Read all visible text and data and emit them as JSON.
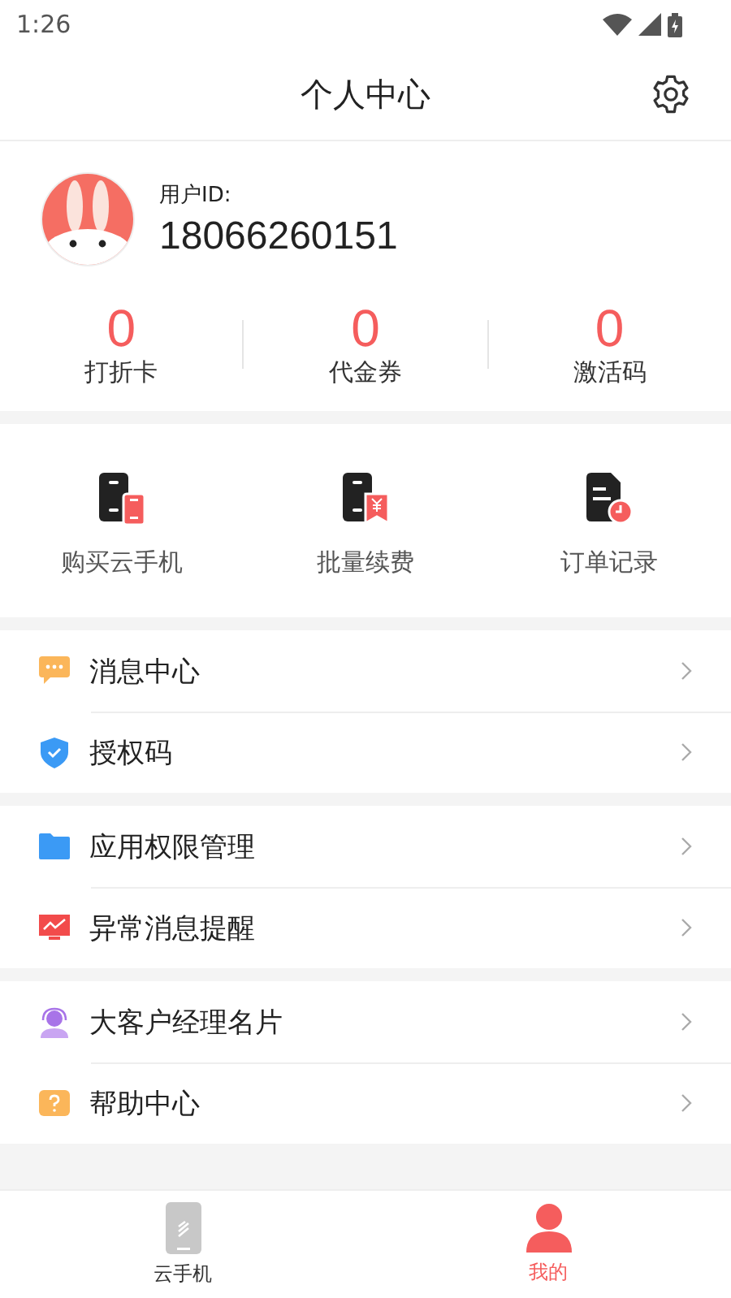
{
  "status_bar": {
    "time": "1:26"
  },
  "header": {
    "title": "个人中心"
  },
  "profile": {
    "id_label": "用户ID:",
    "id_value": "18066260151"
  },
  "stats": [
    {
      "value": "0",
      "label": "打折卡"
    },
    {
      "value": "0",
      "label": "代金券"
    },
    {
      "value": "0",
      "label": "激活码"
    }
  ],
  "shortcuts": [
    {
      "kind": "buy",
      "label": "购买云手机"
    },
    {
      "kind": "renew",
      "label": "批量续费"
    },
    {
      "kind": "orders",
      "label": "订单记录"
    }
  ],
  "menu_groups": [
    {
      "items": [
        {
          "kind": "message",
          "label": "消息中心"
        },
        {
          "kind": "shield",
          "label": "授权码"
        }
      ]
    },
    {
      "items": [
        {
          "kind": "folder",
          "label": "应用权限管理"
        },
        {
          "kind": "monitor",
          "label": "异常消息提醒"
        }
      ]
    },
    {
      "items": [
        {
          "kind": "agent",
          "label": "大客户经理名片"
        },
        {
          "kind": "help",
          "label": "帮助中心"
        }
      ]
    }
  ],
  "tab_bar": [
    {
      "kind": "phone",
      "label": "云手机",
      "selected": false
    },
    {
      "kind": "person",
      "label": "我的",
      "selected": true
    }
  ]
}
